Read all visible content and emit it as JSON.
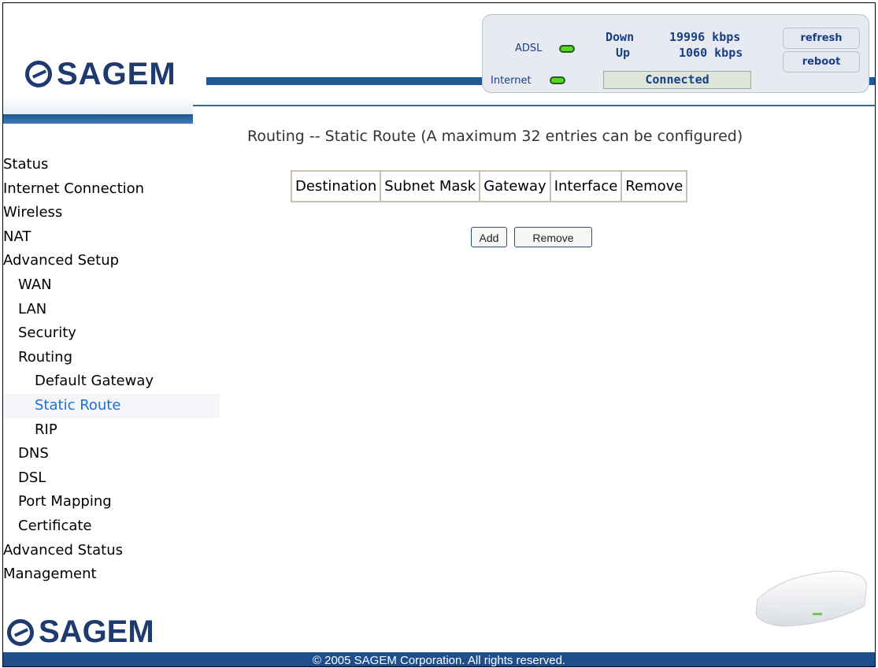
{
  "brand": {
    "name": "SAGEM"
  },
  "status_panel": {
    "adsl_label": "ADSL",
    "internet_label": "Internet",
    "down_label": "Down",
    "down_value": "19996 kbps",
    "up_label": "Up",
    "up_value": "1060 kbps",
    "connection_status": "Connected",
    "refresh_label": "refresh",
    "reboot_label": "reboot",
    "led_color": "#5bd61d"
  },
  "sidebar": {
    "items": [
      {
        "label": "Status",
        "level": 0
      },
      {
        "label": "Internet Connection",
        "level": 0
      },
      {
        "label": "Wireless",
        "level": 0
      },
      {
        "label": "NAT",
        "level": 0
      },
      {
        "label": "Advanced Setup",
        "level": 0
      },
      {
        "label": "WAN",
        "level": 1
      },
      {
        "label": "LAN",
        "level": 1
      },
      {
        "label": "Security",
        "level": 1
      },
      {
        "label": "Routing",
        "level": 1
      },
      {
        "label": "Default Gateway",
        "level": 2
      },
      {
        "label": "Static Route",
        "level": 2,
        "active": true
      },
      {
        "label": "RIP",
        "level": 2
      },
      {
        "label": "DNS",
        "level": 1
      },
      {
        "label": "DSL",
        "level": 1
      },
      {
        "label": "Port Mapping",
        "level": 1
      },
      {
        "label": "Certificate",
        "level": 1
      },
      {
        "label": "Advanced Status",
        "level": 0
      },
      {
        "label": "Management",
        "level": 0
      }
    ],
    "active_color": "#1c6fd6"
  },
  "main": {
    "title": "Routing -- Static Route (A maximum 32 entries can be configured)",
    "table": {
      "columns": [
        "Destination",
        "Subnet Mask",
        "Gateway",
        "Interface",
        "Remove"
      ],
      "rows": []
    },
    "add_label": "Add",
    "remove_label": "Remove"
  },
  "footer": {
    "text": "© 2005 SAGEM Corporation. All rights reserved."
  },
  "colors": {
    "brand_blue": "#1f3a6e",
    "bar_blue": "#1f5a96"
  }
}
